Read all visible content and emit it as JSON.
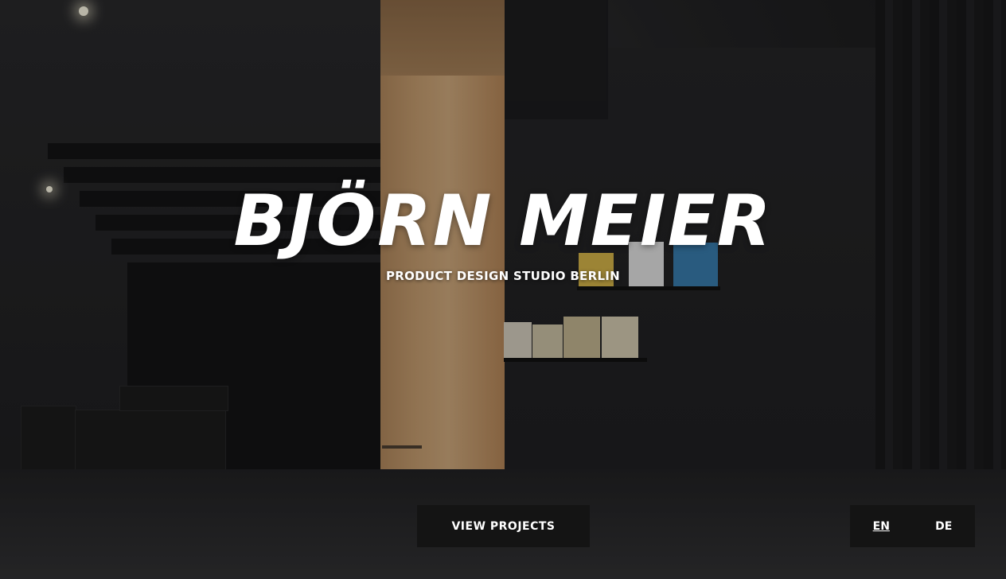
{
  "hero": {
    "title": "BJÖRN MEIER",
    "subtitle": "PRODUCT DESIGN STUDIO BERLIN"
  },
  "actions": {
    "view_projects_label": "VIEW PROJECTS"
  },
  "language": {
    "options": [
      "EN",
      "DE"
    ],
    "selected": "EN"
  }
}
